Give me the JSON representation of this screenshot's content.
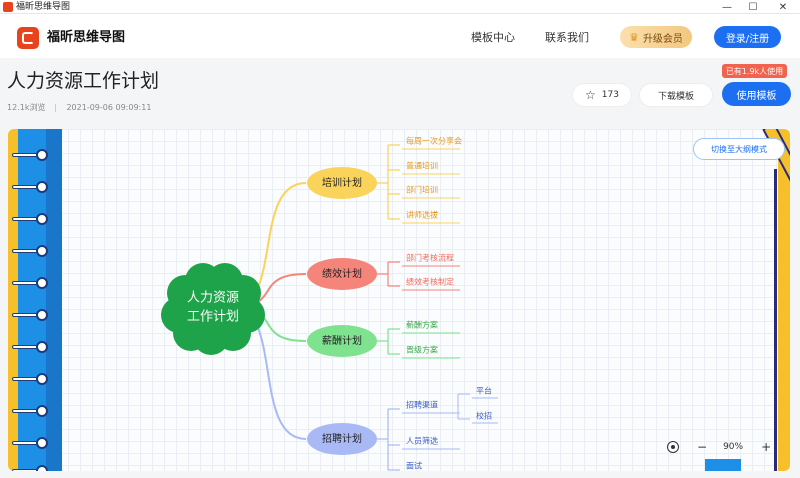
{
  "window": {
    "title": "福昕思维导图",
    "controls": {
      "minimize": "—",
      "maximize": "☐",
      "close": "✕"
    }
  },
  "header": {
    "brand": "福昕思维导图",
    "nav": [
      "模板中心",
      "联系我们"
    ],
    "vip_label": "升级会员",
    "login_label": "登录/注册"
  },
  "template": {
    "title": "人力资源工作计划",
    "views": "12.1k浏览",
    "date": "2021-09-06 09:09:11",
    "used_badge": "已有1.9k人使用",
    "likes": "173",
    "download_label": "下载模板",
    "use_label": "使用模板"
  },
  "canvas": {
    "outline_toggle_label": "切换至大纲模式",
    "zoom": "90%",
    "zoom_minus": "−",
    "zoom_plus": "+"
  },
  "mindmap": {
    "root": "人力资源\n工作计划",
    "root_lines": [
      "人力资源",
      "工作计划"
    ],
    "branches": [
      {
        "label": "培训计划",
        "color": "#f9d35a",
        "text_color": "#e59a1f",
        "children": [
          "每周一次分享会",
          "普通培训",
          "部门培训",
          "讲师选拔"
        ]
      },
      {
        "label": "绩效计划",
        "color": "#f5847a",
        "text_color": "#ee6a5c",
        "children": [
          "部门考核流程",
          "绩效考核制定"
        ]
      },
      {
        "label": "薪酬计划",
        "color": "#7ee28e",
        "text_color": "#3aa84d",
        "children": [
          "薪酬方案",
          "晋级方案"
        ]
      },
      {
        "label": "招聘计划",
        "color": "#a9b9f5",
        "text_color": "#3a5cc5",
        "children": [
          "招聘渠道",
          "人员筛选",
          "面试"
        ],
        "grandchildren": [
          "平台",
          "校招"
        ]
      }
    ],
    "root_color": "#1fa34a"
  }
}
